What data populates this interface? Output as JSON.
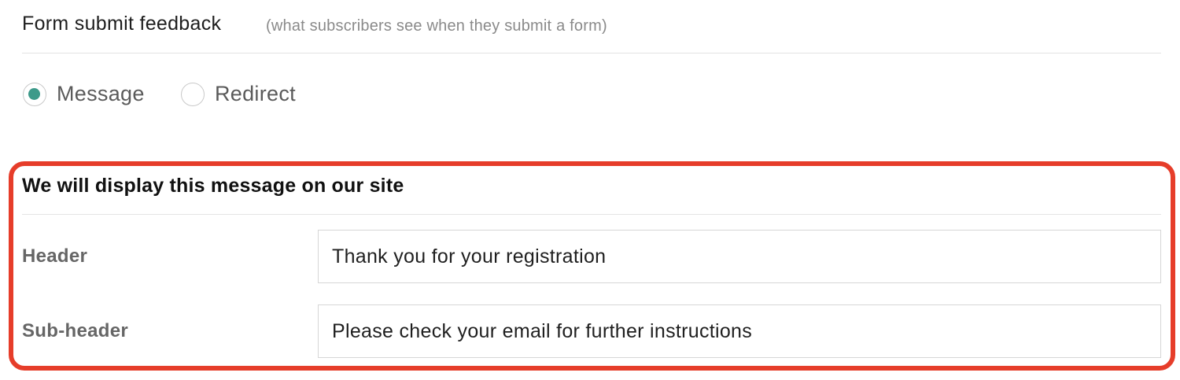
{
  "section": {
    "title": "Form submit feedback",
    "hint": "(what subscribers see when they submit a form)"
  },
  "feedback_type": {
    "selected": "Message",
    "options": [
      {
        "label": "Message",
        "checked": true
      },
      {
        "label": "Redirect",
        "checked": false
      }
    ]
  },
  "message_panel": {
    "title": "We will display this message on our site",
    "fields": [
      {
        "label": "Header",
        "value": "Thank you for your registration",
        "placeholder": ""
      },
      {
        "label": "Sub-header",
        "value": "Please check your email for further instructions",
        "placeholder": ""
      }
    ]
  },
  "colors": {
    "accent": "#3d9a8a",
    "highlight": "#e63d2a",
    "label": "#666666",
    "hint": "#8a8a8a"
  }
}
